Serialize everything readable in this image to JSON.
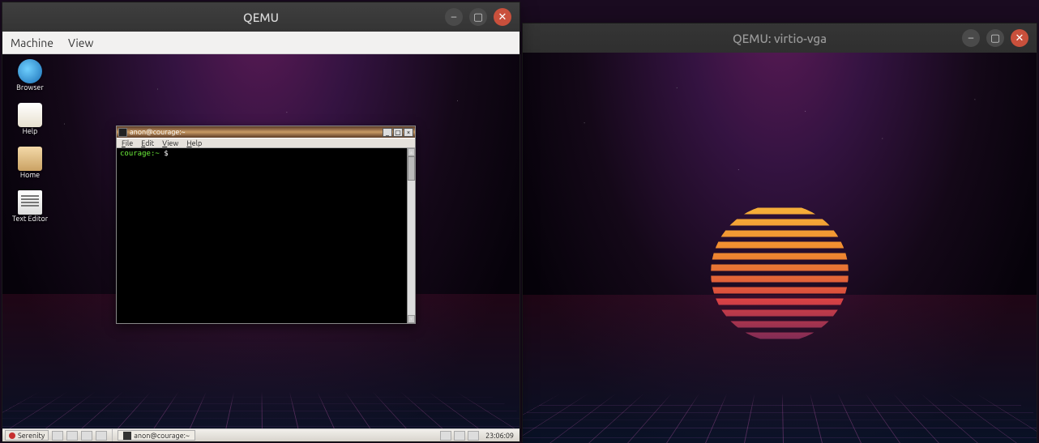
{
  "left": {
    "title": "QEMU",
    "menubar": {
      "machine": "Machine",
      "view": "View"
    },
    "guest": {
      "icons": [
        {
          "name": "browser-icon",
          "label": "Browser"
        },
        {
          "name": "help-icon",
          "label": "Help"
        },
        {
          "name": "home-icon",
          "label": "Home"
        },
        {
          "name": "text-editor-icon",
          "label": "Text Editor"
        }
      ],
      "terminal": {
        "title": "anon@courage:~",
        "menu": {
          "file": "File",
          "edit": "Edit",
          "view": "View",
          "help": "Help"
        },
        "prompt_host": "courage",
        "prompt_path": ":~",
        "prompt_sym": " $ "
      },
      "taskbar": {
        "start": "Serenity",
        "task_label": "anon@courage:~",
        "clock": "23:06:09"
      }
    }
  },
  "right": {
    "title": "QEMU: virtio-vga"
  }
}
